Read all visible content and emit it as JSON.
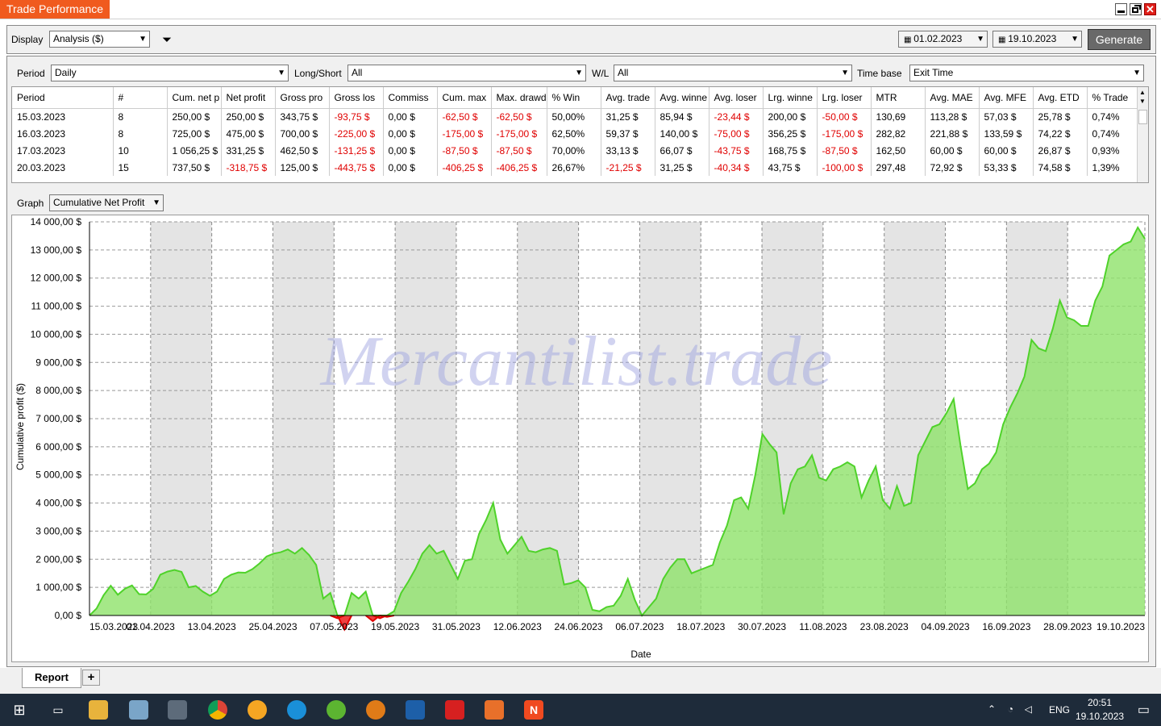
{
  "window": {
    "title": "Trade Performance"
  },
  "toolbar": {
    "display_label": "Display",
    "display_value": "Analysis ($)",
    "date_from": "01.02.2023",
    "date_to": "19.10.2023",
    "generate_label": "Generate"
  },
  "filters": {
    "period_label": "Period",
    "period_value": "Daily",
    "longshort_label": "Long/Short",
    "longshort_value": "All",
    "wl_label": "W/L",
    "wl_value": "All",
    "timebase_label": "Time base",
    "timebase_value": "Exit Time"
  },
  "table": {
    "columns": [
      "Period",
      "#",
      "Cum. net p",
      "Net profit",
      "Gross pro",
      "Gross los",
      "Commiss",
      "Cum. max",
      "Max. drawd",
      "% Win",
      "Avg. trade",
      "Avg. winne",
      "Avg. loser",
      "Lrg. winne",
      "Lrg. loser",
      "MTR",
      "Avg. MAE",
      "Avg. MFE",
      "Avg. ETD",
      "% Trade"
    ],
    "rows": [
      [
        "15.03.2023",
        "8",
        "250,00 $",
        "250,00 $",
        "343,75 $",
        "-93,75 $",
        "0,00 $",
        "-62,50 $",
        "-62,50 $",
        "50,00%",
        "31,25 $",
        "85,94 $",
        "-23,44 $",
        "200,00 $",
        "-50,00 $",
        "130,69",
        "113,28 $",
        "57,03 $",
        "25,78 $",
        "0,74%"
      ],
      [
        "16.03.2023",
        "8",
        "725,00 $",
        "475,00 $",
        "700,00 $",
        "-225,00 $",
        "0,00 $",
        "-175,00 $",
        "-175,00 $",
        "62,50%",
        "59,37 $",
        "140,00 $",
        "-75,00 $",
        "356,25 $",
        "-175,00 $",
        "282,82",
        "221,88 $",
        "133,59 $",
        "74,22 $",
        "0,74%"
      ],
      [
        "17.03.2023",
        "10",
        "1 056,25 $",
        "331,25 $",
        "462,50 $",
        "-131,25 $",
        "0,00 $",
        "-87,50 $",
        "-87,50 $",
        "70,00%",
        "33,13 $",
        "66,07 $",
        "-43,75 $",
        "168,75 $",
        "-87,50 $",
        "162,50",
        "60,00 $",
        "60,00 $",
        "26,87 $",
        "0,93%"
      ],
      [
        "20.03.2023",
        "15",
        "737,50 $",
        "-318,75 $",
        "125,00 $",
        "-443,75 $",
        "0,00 $",
        "-406,25 $",
        "-406,25 $",
        "26,67%",
        "-21,25 $",
        "31,25 $",
        "-40,34 $",
        "43,75 $",
        "-100,00 $",
        "297,48",
        "72,92 $",
        "53,33 $",
        "74,58 $",
        "1,39%"
      ]
    ]
  },
  "graph": {
    "label": "Graph",
    "type_value": "Cumulative Net Profit"
  },
  "chart_data": {
    "type": "area",
    "xlabel": "Date",
    "ylabel": "Cumulative profit ($)",
    "ylim": [
      0,
      14000
    ],
    "y_ticks": [
      "0,00 $",
      "1 000,00 $",
      "2 000,00 $",
      "3 000,00 $",
      "4 000,00 $",
      "5 000,00 $",
      "6 000,00 $",
      "7 000,00 $",
      "8 000,00 $",
      "9 000,00 $",
      "10 000,00 $",
      "11 000,00 $",
      "12 000,00 $",
      "13 000,00 $",
      "14 000,00 $"
    ],
    "x_ticks": [
      "15.03.2023",
      "01.04.2023",
      "13.04.2023",
      "25.04.2023",
      "07.05.2023",
      "19.05.2023",
      "31.05.2023",
      "12.06.2023",
      "24.06.2023",
      "06.07.2023",
      "18.07.2023",
      "30.07.2023",
      "11.08.2023",
      "23.08.2023",
      "04.09.2023",
      "16.09.2023",
      "28.09.2023",
      "19.10.2023"
    ],
    "watermark": "Mercantilist.trade",
    "series": [
      {
        "values": [
          0,
          250,
          725,
          1056,
          738,
          950,
          1070,
          760,
          750,
          950,
          1450,
          1560,
          1620,
          1550,
          1000,
          1050,
          850,
          700,
          850,
          1300,
          1450,
          1530,
          1520,
          1650,
          1850,
          2100,
          2200,
          2250,
          2350,
          2200,
          2400,
          2150,
          1800,
          600,
          800,
          -100,
          -500,
          800,
          600,
          850,
          -200,
          -100,
          -50,
          150,
          800,
          1200,
          1650,
          2200,
          2500,
          2200,
          2300,
          1800,
          1300,
          1950,
          2000,
          2900,
          3400,
          4000,
          2700,
          2200,
          2500,
          2800,
          2300,
          2250,
          2350,
          2400,
          2300,
          1100,
          1150,
          1250,
          1000,
          200,
          150,
          300,
          350,
          700,
          1300,
          550,
          0,
          300,
          600,
          1300,
          1700,
          2000,
          2000,
          1500,
          1600,
          1700,
          1800,
          2600,
          3200,
          4100,
          4200,
          3800,
          5000,
          6450,
          6100,
          5800,
          3600,
          4700,
          5200,
          5300,
          5700,
          4900,
          4800,
          5200,
          5300,
          5450,
          5300,
          4200,
          4800,
          5300,
          4100,
          3800,
          4600,
          3900,
          4000,
          5700,
          6200,
          6700,
          6800,
          7200,
          7700,
          6000,
          4500,
          4700,
          5200,
          5400,
          5800,
          6800,
          7400,
          7900,
          8500,
          9800,
          9500,
          9400,
          10200,
          11200,
          10600,
          10500,
          10300,
          10300,
          11200,
          11700,
          12800,
          13000,
          13200,
          13300,
          13800,
          13400
        ]
      }
    ]
  },
  "tabs": {
    "report_label": "Report",
    "add_label": "+"
  },
  "taskbar": {
    "lang": "ENG",
    "time": "20:51",
    "date": "19.10.2023"
  }
}
